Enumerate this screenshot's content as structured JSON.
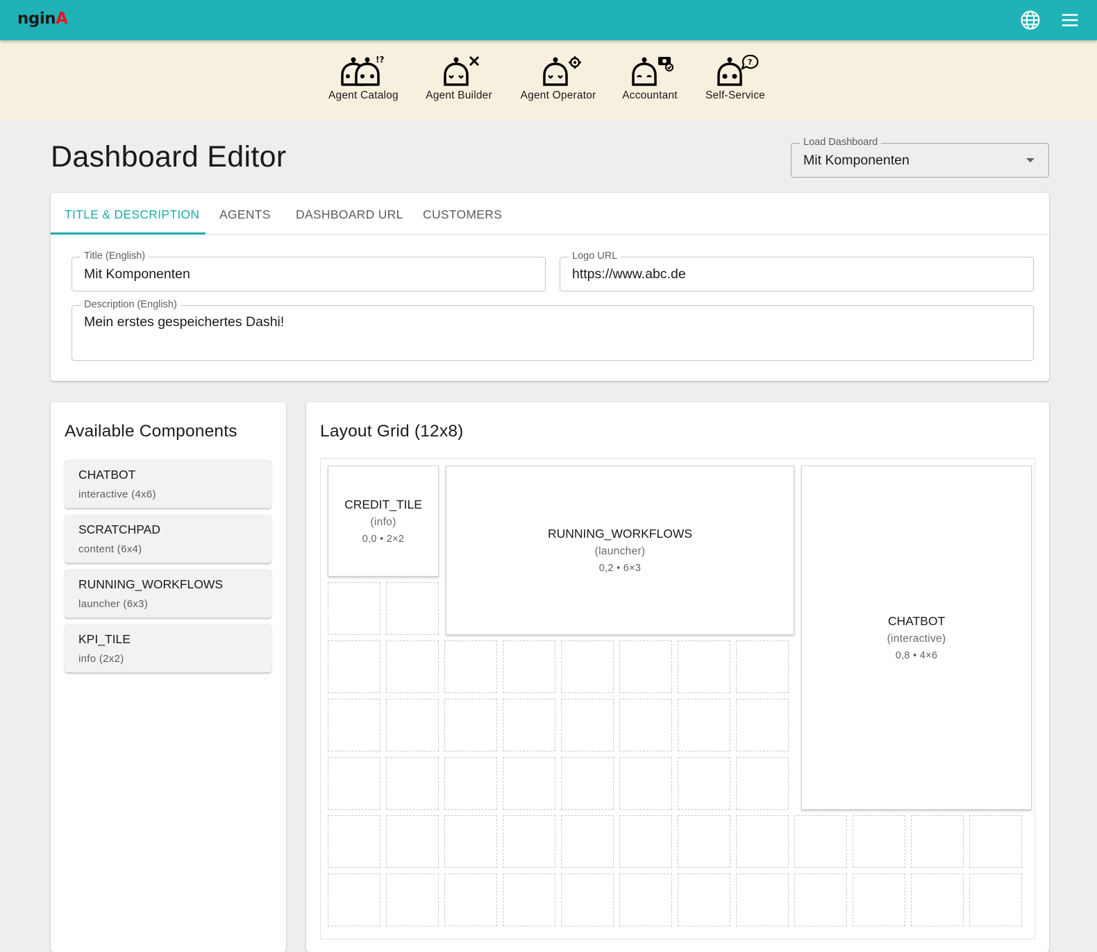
{
  "app": {
    "logo_part1": "ngin",
    "logo_part2": "A"
  },
  "colors": {
    "primary": "#1fb2b7",
    "accent": "#1fa9ae",
    "nav_bg": "#f7f0df",
    "logo_red": "#e0191f"
  },
  "topbar": {
    "icons": [
      "globe-icon",
      "hamburger-menu-icon"
    ]
  },
  "agents": [
    {
      "label": "Agent Catalog",
      "icon": "agent-catalog-robot-icon"
    },
    {
      "label": "Agent Builder",
      "icon": "agent-builder-robot-icon"
    },
    {
      "label": "Agent Operator",
      "icon": "agent-operator-robot-icon"
    },
    {
      "label": "Accountant",
      "icon": "accountant-robot-icon"
    },
    {
      "label": "Self-Service",
      "icon": "self-service-robot-icon"
    }
  ],
  "page": {
    "title": "Dashboard Editor"
  },
  "load_dashboard": {
    "label": "Load Dashboard",
    "value": "Mit Komponenten"
  },
  "tabs": [
    {
      "label": "TITLE & DESCRIPTION",
      "active": true
    },
    {
      "label": "AGENTS",
      "active": false
    },
    {
      "label": "DASHBOARD URL",
      "active": false
    },
    {
      "label": "CUSTOMERS",
      "active": false
    }
  ],
  "form": {
    "title": {
      "label": "Title (English)",
      "value": "Mit Komponenten"
    },
    "logo": {
      "label": "Logo URL",
      "value": "https://www.abc.de"
    },
    "description": {
      "label": "Description (English)",
      "value": "Mein erstes gespeichertes Dashi!"
    }
  },
  "components": {
    "title": "Available Components",
    "items": [
      {
        "name": "CHATBOT",
        "meta": "interactive (4x6)"
      },
      {
        "name": "SCRATCHPAD",
        "meta": "content (6x4)"
      },
      {
        "name": "RUNNING_WORKFLOWS",
        "meta": "launcher (6x3)"
      },
      {
        "name": "KPI_TILE",
        "meta": "info (2x2)"
      }
    ]
  },
  "layout": {
    "title": "Layout Grid (12x8)",
    "placed": [
      {
        "name": "CREDIT_TILE",
        "type": "(info)",
        "pos": "0,0 • 2×2"
      },
      {
        "name": "RUNNING_WORKFLOWS",
        "type": "(launcher)",
        "pos": "0,2 • 6×3"
      },
      {
        "name": "CHATBOT",
        "type": "(interactive)",
        "pos": "0,8 • 4×6"
      }
    ]
  }
}
